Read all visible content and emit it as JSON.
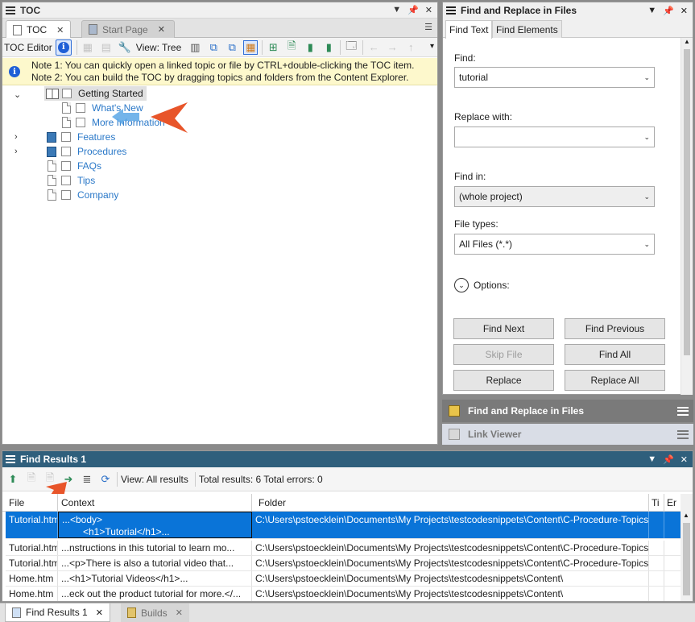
{
  "toc_pane": {
    "title": "TOC",
    "tabs": [
      {
        "label": "TOC",
        "close": "✕"
      },
      {
        "label": "Start Page",
        "close": "✕"
      }
    ],
    "toolbar": {
      "editor_label": "TOC Editor",
      "view_label": "View: Tree"
    },
    "notes": [
      "Note 1: You can quickly open a linked topic or file by CTRL+double-clicking the TOC item.",
      "Note 2: You can build the TOC by dragging topics and folders from the Content Explorer."
    ],
    "tree": [
      {
        "label": "Getting Started",
        "type": "book-open",
        "expanded": true,
        "selected": true
      },
      {
        "label": "What's New",
        "type": "page",
        "level": 2
      },
      {
        "label": "More Information",
        "type": "page",
        "level": 2
      },
      {
        "label": "Features",
        "type": "book",
        "collapsed": true
      },
      {
        "label": "Procedures",
        "type": "book",
        "collapsed": true
      },
      {
        "label": "FAQs",
        "type": "page"
      },
      {
        "label": "Tips",
        "type": "page"
      },
      {
        "label": "Company",
        "type": "page"
      }
    ]
  },
  "find_replace": {
    "title": "Find and Replace in Files",
    "tabs": [
      "Find Text",
      "Find Elements"
    ],
    "find_label": "Find:",
    "find_value": "tutorial",
    "replace_label": "Replace with:",
    "replace_value": "",
    "find_in_label": "Find in:",
    "find_in_value": "(whole project)",
    "file_types_label": "File types:",
    "file_types_value": "All Files (*.*)",
    "options_label": "Options:",
    "buttons": {
      "find_next": "Find Next",
      "find_previous": "Find Previous",
      "skip_file": "Skip File",
      "find_all": "Find All",
      "replace": "Replace",
      "replace_all": "Replace All"
    }
  },
  "collapsed_panes": {
    "find_replace": "Find and Replace in Files",
    "link_viewer": "Link Viewer"
  },
  "find_results": {
    "title": "Find Results 1",
    "view_label": "View: All results",
    "totals": "Total results: 6 Total errors: 0",
    "columns": [
      "File",
      "Context",
      "Folder",
      "Ti",
      "Er"
    ],
    "rows": [
      {
        "file": "Tutorial.htm",
        "context": "...<body>",
        "context2": "<h1>Tutorial</h1>...",
        "folder": "C:\\Users\\pstoecklein\\Documents\\My Projects\\testcodesnippets\\Content\\C-Procedure-Topics",
        "selected": true
      },
      {
        "file": "Tutorial.htm",
        "context": "...nstructions in this tutorial to learn mo...",
        "folder": "C:\\Users\\pstoecklein\\Documents\\My Projects\\testcodesnippets\\Content\\C-Procedure-Topics"
      },
      {
        "file": "Tutorial.htm",
        "context": "...<p>There is also a tutorial video that...",
        "folder": "C:\\Users\\pstoecklein\\Documents\\My Projects\\testcodesnippets\\Content\\C-Procedure-Topics"
      },
      {
        "file": "Home.htm",
        "context": "...<h1>Tutorial Videos</h1>...",
        "folder": "C:\\Users\\pstoecklein\\Documents\\My Projects\\testcodesnippets\\Content\\"
      },
      {
        "file": "Home.htm",
        "context": "...eck out the product tutorial for more.</...",
        "folder": "C:\\Users\\pstoecklein\\Documents\\My Projects\\testcodesnippets\\Content\\"
      }
    ]
  },
  "bottom_tabs": [
    {
      "label": "Find Results 1",
      "close": "✕"
    },
    {
      "label": "Builds",
      "close": "✕"
    }
  ],
  "colors": {
    "accent": "#0a74d8",
    "results_title": "#2f5f7c",
    "link": "#2a78c8",
    "note_bg": "#fdf8cc",
    "annotation_arrow": "#e8552a"
  }
}
